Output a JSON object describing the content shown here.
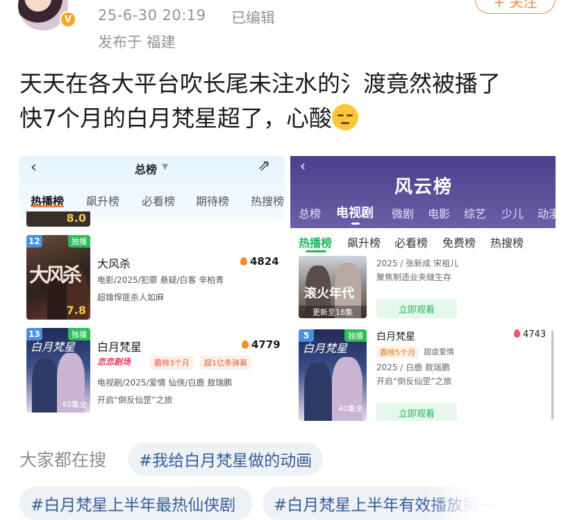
{
  "post": {
    "time": "25-6-30 20:19",
    "edited": "已编辑",
    "location": "发布于 福建",
    "follow_label": "+ 关注",
    "text_line1": "天天在各大平台吹长尾未注水的氵渡竟然被播了",
    "text_line2": "快7个月的白月梵星超了，心酸"
  },
  "left_screenshot": {
    "back": "‹",
    "title": "总榜",
    "tabs": [
      "热播榜",
      "飙升榜",
      "必看榜",
      "期待榜",
      "热搜榜"
    ],
    "prev_score": "8.0",
    "items": [
      {
        "rank": "12",
        "exclusive": "独播",
        "poster_text": "大风杀",
        "score": "7.8",
        "name": "大风杀",
        "heat": "4824",
        "meta": "电影/2025/犯罪 悬疑/白客 辛柏青",
        "desc": "超雄悍匪杀人如麻"
      },
      {
        "rank": "13",
        "exclusive": "独播",
        "poster_text": "白月梵星",
        "episodes": "40集全",
        "name": "白月梵星",
        "heat": "4779",
        "logo": "恋恋剧场",
        "tags": [
          "霸榜3个月",
          "超1亿条弹幕"
        ],
        "meta": "电视剧/2025/爱情 仙侠/白鹿 敖瑞鹏",
        "desc": "开启“倒反仙罡”之旅"
      }
    ]
  },
  "right_screenshot": {
    "back": "‹",
    "title": "风云榜",
    "categories": [
      "总榜",
      "电视剧",
      "微剧",
      "电影",
      "综艺",
      "少儿",
      "动漫"
    ],
    "tabs": [
      "热播榜",
      "飙升榜",
      "必看榜",
      "免费榜",
      "热搜榜"
    ],
    "items": [
      {
        "poster_text": "滚火年代",
        "update": "更新至18集",
        "meta1": "2025 / 张新成 宋祖儿",
        "meta2": "聚焦制造业夹缝生存",
        "watch": "立即观看"
      },
      {
        "rank": "5",
        "exclusive": "独播",
        "poster_text": "白月梵星",
        "episodes": "40集全",
        "name": "白月梵星",
        "heat": "4743",
        "tag1": "霸榜5个月",
        "tag2": "甜虐爱情",
        "meta1": "2025 / 白鹿 敖瑞鹏",
        "meta2": "开启“倒反仙罡”之旅",
        "watch": "立即观看"
      }
    ]
  },
  "search": {
    "label": "大家都在搜",
    "hashtags": [
      "#我给白月梵星做的动画",
      "#白月梵星上半年最热仙侠剧",
      "#白月梵星上半年有效播放第一"
    ]
  },
  "colors": {
    "hashtag_text": "#365e96",
    "hashtag_bg": "#eef2f7",
    "meta_gray": "#939393",
    "accent_green": "#1fb85a",
    "accent_orange": "#f08a3a"
  }
}
